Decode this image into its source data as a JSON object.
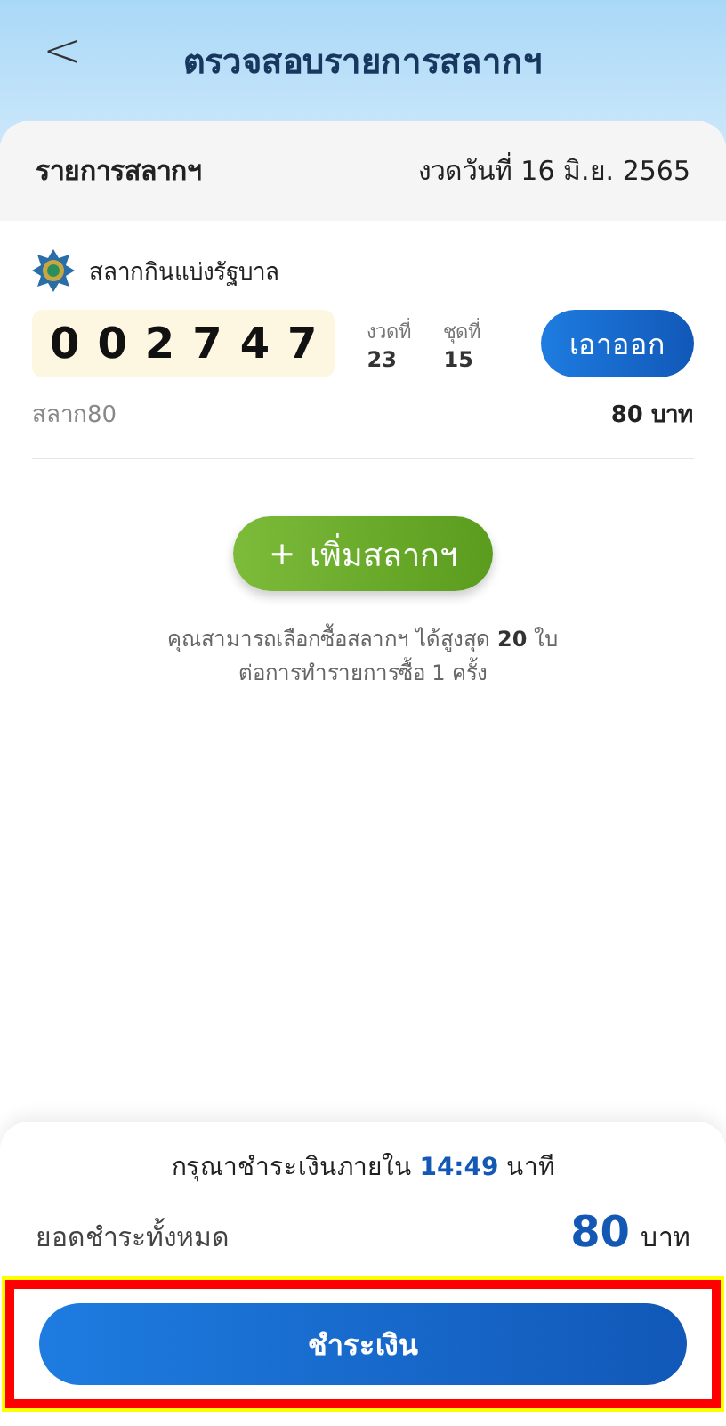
{
  "header": {
    "back": "<",
    "title": "ตรวจสอบรายการสลากฯ"
  },
  "list_header": {
    "title": "รายการสลากฯ",
    "draw_date": "งวดวันที่ 16 มิ.ย. 2565"
  },
  "tickets": [
    {
      "issuer": "สลากกินแบ่งรัฐบาล",
      "number": [
        "0",
        "0",
        "2",
        "7",
        "4",
        "7"
      ],
      "draw_label": "งวดที่",
      "draw": "23",
      "set_label": "ชุดที่",
      "set": "15",
      "remove": "เอาออก",
      "type": "สลาก80",
      "price": "80 บาท"
    }
  ],
  "add_button": {
    "icon": "+",
    "label": "เพิ่มสลากฯ"
  },
  "note": [
    "คุณสามารถเลือกซื้อสลากฯ ได้สูงสุด **20**  ใบ",
    "ต่อการทำรายการซื้อ 1 ครั้ง"
  ],
  "payment": {
    "deadline": "กรุณาชำระเงินภายใน **14:49** นาที",
    "total_label": "ยอดชำระทั้งหมด",
    "total": "80",
    "currency": "บาท",
    "pay_button": {
      "label": "ชำระเงิน",
      "highlighted": true
    }
  }
}
